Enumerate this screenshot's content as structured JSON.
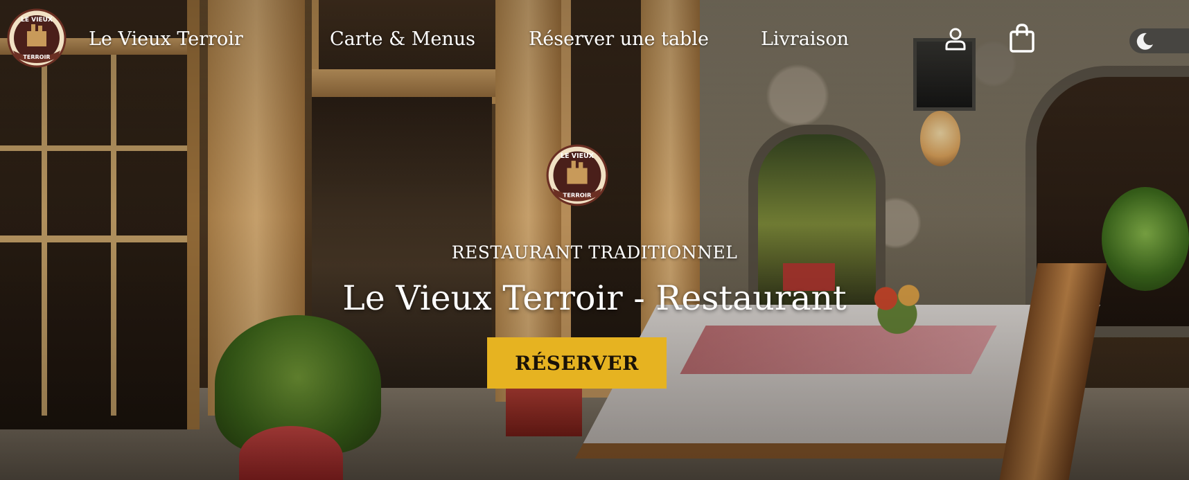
{
  "colors": {
    "accent": "#e6b321",
    "nav_text": "#ffffff",
    "cta_text": "#1a1208"
  },
  "nav": {
    "logo": {
      "icon": "restaurant-logo-badge",
      "logo_text_top": "LE VIEUX",
      "logo_text_bottom": "TERROIR"
    },
    "brand": "Le Vieux Terroir",
    "links": [
      "Carte & Menus",
      "Réserver une table",
      "Livraison"
    ],
    "account_icon": "user-icon",
    "cart_icon": "shopping-bag-icon",
    "theme_toggle_icon": "moon-icon"
  },
  "hero": {
    "emblem": {
      "icon": "restaurant-logo-badge"
    },
    "eyebrow": "RESTAURANT TRADITIONNEL",
    "title": "Le Vieux Terroir - Restaurant",
    "cta_label": "RÉSERVER"
  }
}
